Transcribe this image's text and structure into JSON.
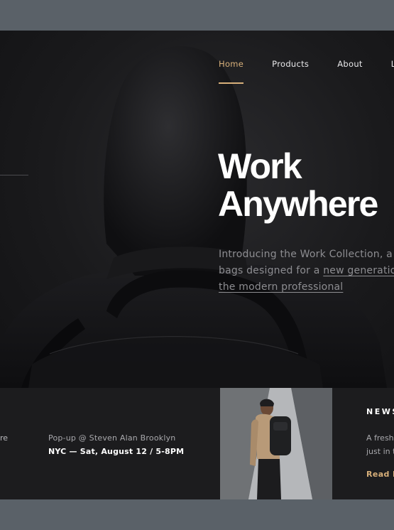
{
  "nav": {
    "items": [
      {
        "label": "Home",
        "active": true
      },
      {
        "label": "Products",
        "active": false
      },
      {
        "label": "About",
        "active": false
      },
      {
        "label": "Lo",
        "active": false
      }
    ]
  },
  "hero": {
    "headline_line1": "Work",
    "headline_line2": "Anywhere",
    "intro_line1": "Introducing the Work Collection, a l",
    "intro_line2_text": "bags designed for a ",
    "intro_link_part1": "new generation",
    "intro_link_part2": "the modern professional"
  },
  "event": {
    "prev_fragment": "re",
    "title": "Pop-up @ Steven Alan Brooklyn",
    "date": "NYC — Sat, August 12 / 5-8PM"
  },
  "news": {
    "label": "NEWS",
    "text_line1": "A fresh",
    "text_line2": "just in t",
    "read_more": "Read M"
  },
  "colors": {
    "accent": "#d8b07a",
    "background": "#161618",
    "frame": "#5a6168"
  }
}
